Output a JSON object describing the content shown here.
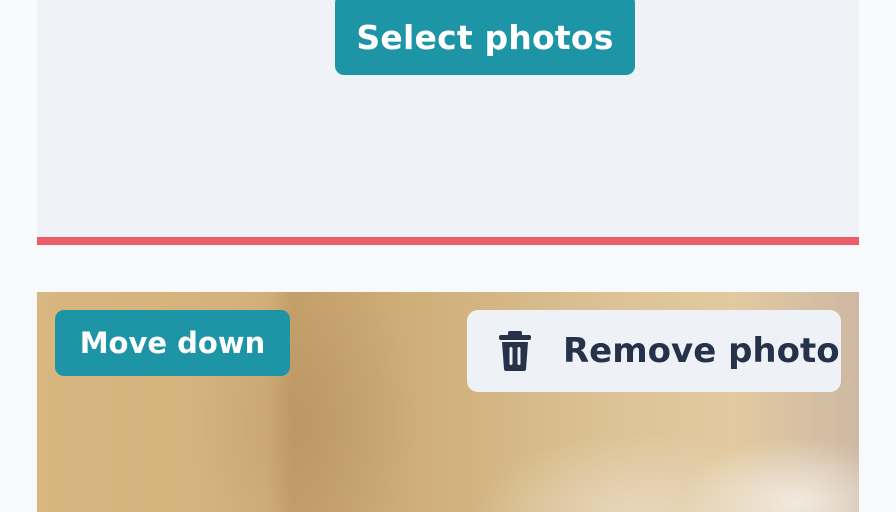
{
  "upload": {
    "select_label": "Select photos"
  },
  "photo": {
    "move_down_label": "Move down",
    "remove_label": "Remove photo",
    "remove_icon": "trash-icon"
  },
  "colors": {
    "accent": "#1e95a6",
    "error": "#ee5c65",
    "panel": "#eff3f8",
    "text_dark": "#253249"
  }
}
